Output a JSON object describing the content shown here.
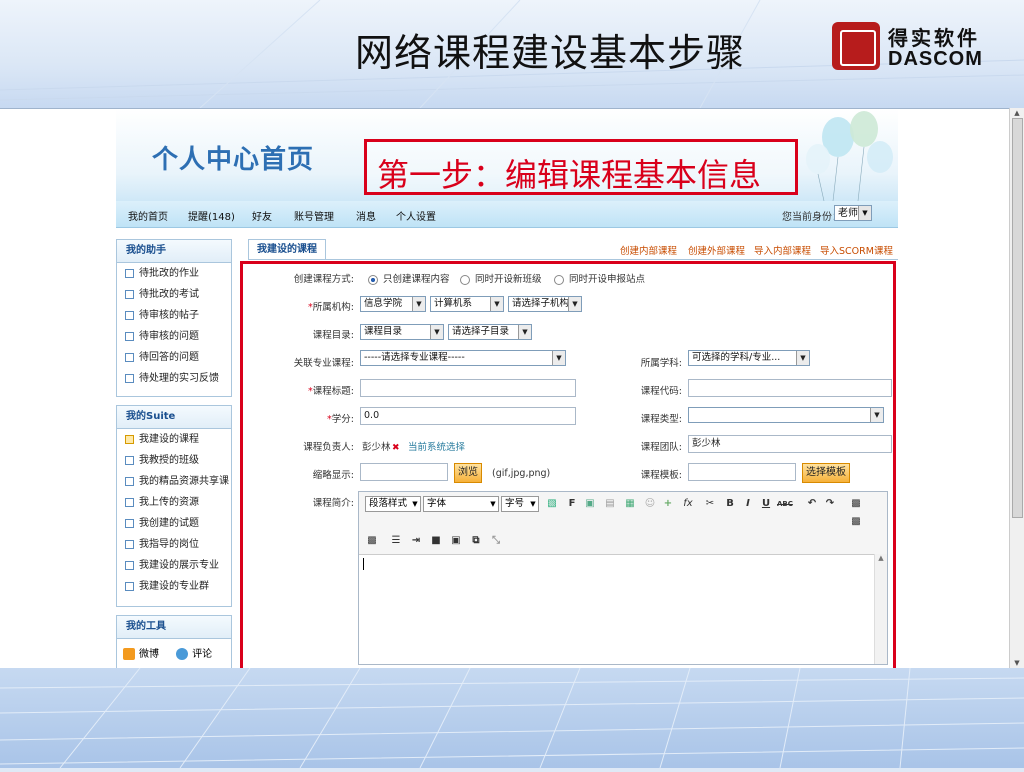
{
  "slide": {
    "title": "网络课程建设基本步骤"
  },
  "logo": {
    "cn": "得实软件",
    "en": "DASCOM"
  },
  "banner": {
    "home_title": "个人中心首页",
    "step_text": "第一步：编辑课程基本信息"
  },
  "nav": {
    "items": [
      "我的首页",
      "提醒(148)",
      "好友",
      "账号管理",
      "消息",
      "个人设置"
    ],
    "role_label": "您当前身份：",
    "role_value": "老师"
  },
  "sidebar": {
    "assistant": {
      "title": "我的助手",
      "items": [
        "待批改的作业",
        "待批改的考试",
        "待审核的帖子",
        "待审核的问题",
        "待回答的问题",
        "待处理的实习反馈"
      ]
    },
    "suite": {
      "title": "我的Suite",
      "items": [
        "我建设的课程",
        "我教授的班级",
        "我的精品资源共享课",
        "我上传的资源",
        "我创建的试题",
        "我指导的岗位",
        "我建设的展示专业",
        "我建设的专业群"
      ]
    },
    "tools": {
      "title": "我的工具",
      "items": [
        "微博",
        "评论"
      ]
    }
  },
  "content": {
    "tab": "我建设的课程",
    "top_links": [
      "创建内部课程",
      "创建外部课程",
      "导入内部课程",
      "导入SCORM课程"
    ]
  },
  "form": {
    "mode_label": "创建课程方式:",
    "modes": [
      "只创建课程内容",
      "同时开设新班级",
      "同时开设申报站点"
    ],
    "org_label": "所属机构:",
    "org_values": [
      "信息学院",
      "计算机系",
      "请选择子机构"
    ],
    "catalog_label": "课程目录:",
    "catalog_values": [
      "课程目录",
      "请选择子目录"
    ],
    "major_label": "关联专业课程:",
    "major_value": "-----请选择专业课程-----",
    "subject_label": "所属学科:",
    "subject_value": "可选择的学科/专业...",
    "title_label": "课程标题:",
    "code_label": "课程代码:",
    "credit_label": "学分:",
    "credit_value": "0.0",
    "type_label": "课程类型:",
    "owner_label": "课程负责人:",
    "owner_value": "彭少林",
    "owner_link": "当前系统选择",
    "team_label": "课程团队:",
    "team_value": "彭少林",
    "thumb_label": "缩略显示:",
    "browse_button": "浏览",
    "thumb_hint": "(gif,jpg,png)",
    "template_label": "课程模板:",
    "template_button": "选择模板",
    "intro_label": "课程简介:"
  },
  "editor": {
    "style_select": "段落样式",
    "font_select": "字体",
    "size_select": "字号"
  },
  "colors": {
    "accent_red": "#d9001b",
    "link_orange": "#c84c00",
    "nav_blue": "#1a4f8f"
  }
}
